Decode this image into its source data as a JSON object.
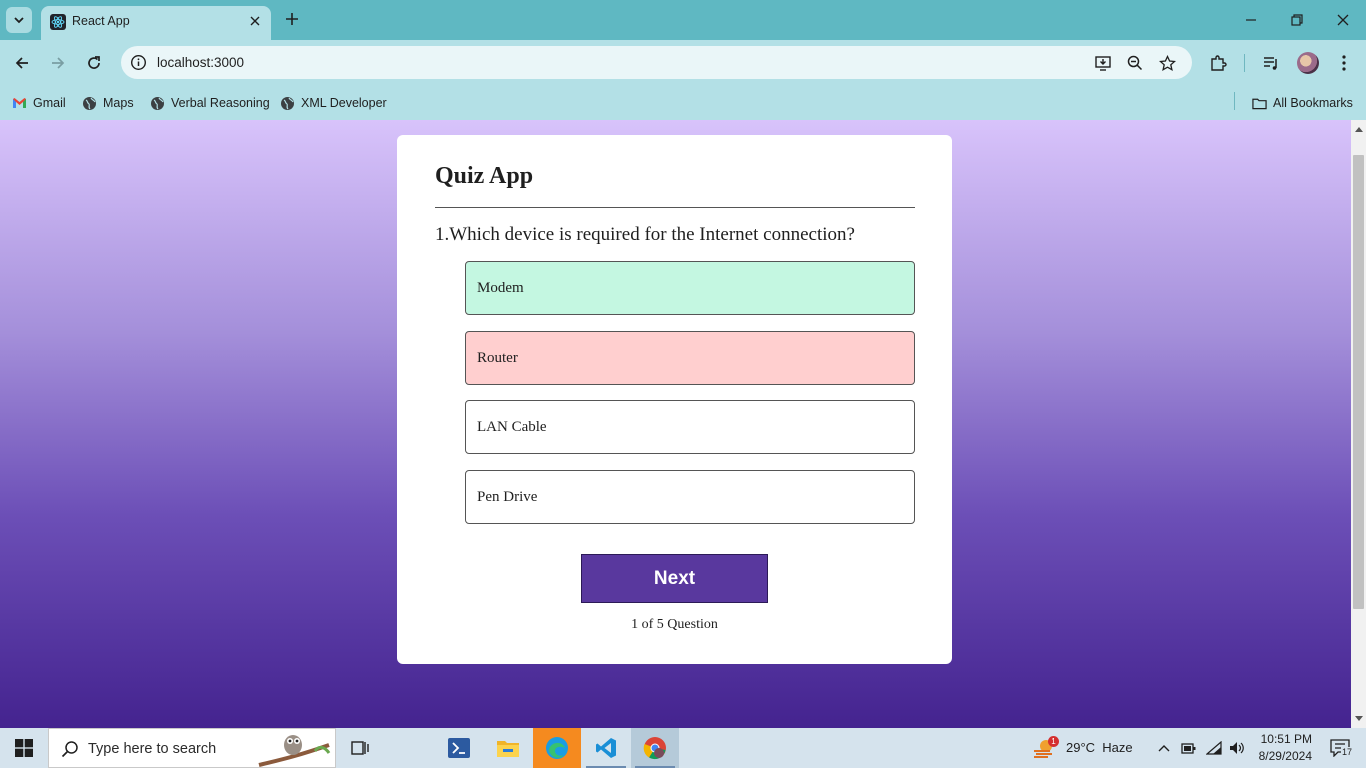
{
  "browser": {
    "tab_title": "React App",
    "url": "localhost:3000",
    "bookmarks": [
      {
        "label": "Gmail",
        "icon": "gmail-icon"
      },
      {
        "label": "Maps",
        "icon": "globe-icon"
      },
      {
        "label": "Verbal Reasoning",
        "icon": "globe-icon"
      },
      {
        "label": "XML Developer",
        "icon": "globe-icon"
      }
    ],
    "all_bookmarks_label": "All Bookmarks"
  },
  "quiz": {
    "title": "Quiz App",
    "question": "1.Which device is required for the Internet connection?",
    "options": [
      {
        "label": "Modem",
        "state": "correct"
      },
      {
        "label": "Router",
        "state": "wrong"
      },
      {
        "label": "LAN Cable",
        "state": "none"
      },
      {
        "label": "Pen Drive",
        "state": "none"
      }
    ],
    "next_label": "Next",
    "progress_text": "1 of 5 Question"
  },
  "colors": {
    "correct_bg": "#c4f7e1",
    "wrong_bg": "#ffcfcf",
    "button_bg": "#59389e",
    "browser_frame": "#5fb8c2"
  },
  "taskbar": {
    "search_placeholder": "Type here to search",
    "weather_badge": "1",
    "weather": "29°C  Haze",
    "time": "10:51 PM",
    "date": "8/29/2024",
    "notifications": "17"
  }
}
